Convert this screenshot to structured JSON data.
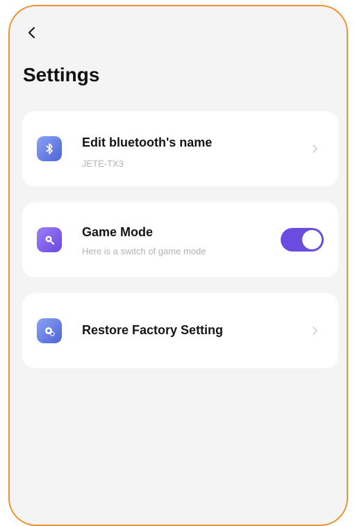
{
  "header": {
    "back_icon": "chevron-left-icon",
    "title": "Settings"
  },
  "settings": {
    "bluetooth": {
      "label": "Edit bluetooth's name",
      "value": "JETE-TX3",
      "icon": "bluetooth-icon",
      "icon_color": "#5b6fe0"
    },
    "game_mode": {
      "label": "Game Mode",
      "description": "Here is a switch of game mode",
      "icon": "game-mode-icon",
      "icon_color": "#7b57e6",
      "enabled": true
    },
    "restore": {
      "label": "Restore Factory Setting",
      "icon": "restore-settings-icon",
      "icon_color": "#5b6fe0"
    }
  },
  "colors": {
    "accent": "#6b4ce0",
    "frame_border": "#f0902c",
    "background": "#f4f4f5",
    "card": "#ffffff"
  }
}
